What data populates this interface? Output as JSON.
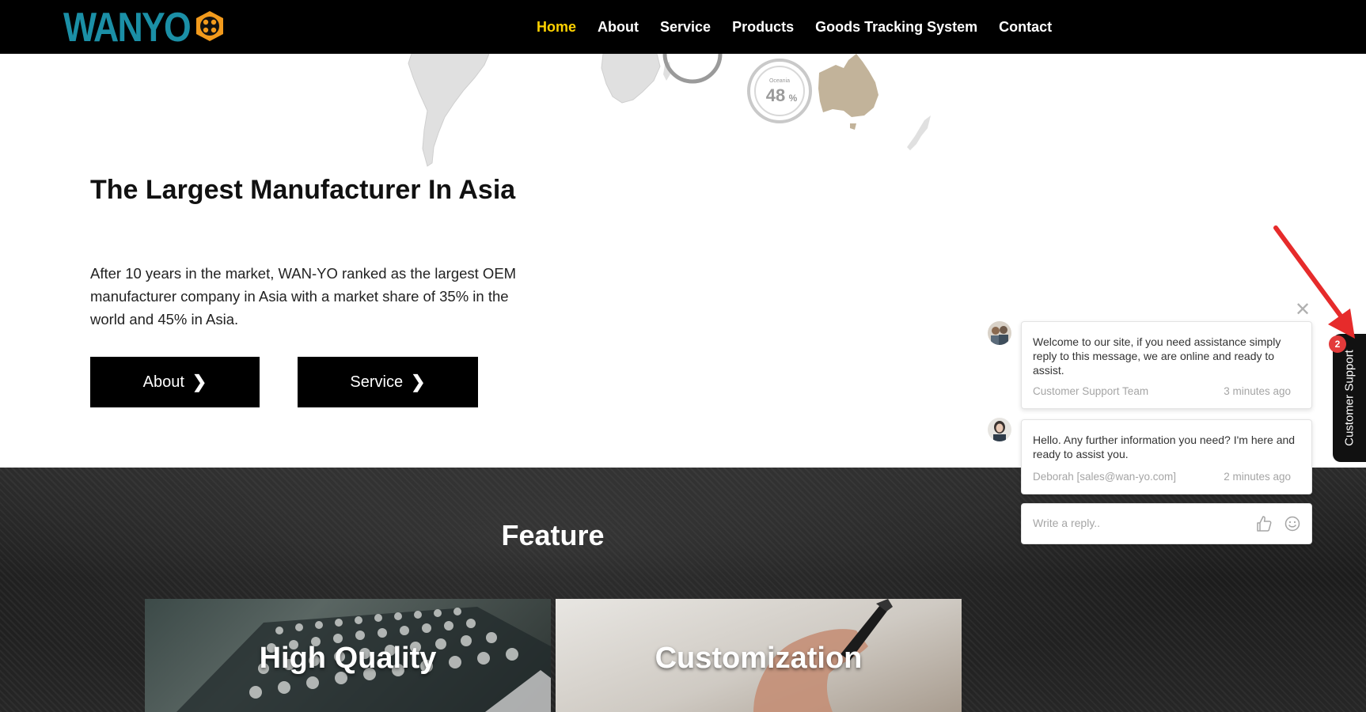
{
  "header": {
    "logo_text": "WANYO",
    "nav": [
      {
        "label": "Home",
        "active": true
      },
      {
        "label": "About",
        "active": false
      },
      {
        "label": "Service",
        "active": false
      },
      {
        "label": "Products",
        "active": false
      },
      {
        "label": "Goods Tracking System",
        "active": false
      },
      {
        "label": "Contact",
        "active": false
      }
    ]
  },
  "map": {
    "region_label": "Oceania",
    "share_value": "48",
    "share_unit": "%"
  },
  "intro": {
    "title": "The Largest Manufacturer In Asia",
    "text": "After 10 years in the market, WAN-YO ranked as the largest OEM manufacturer company in Asia with a market share of 35% in the world and 45% in Asia.",
    "buttons": [
      {
        "label": "About"
      },
      {
        "label": "Service"
      }
    ]
  },
  "feature": {
    "title": "Feature",
    "cards": [
      {
        "title": "High Quality"
      },
      {
        "title": "Customization"
      }
    ]
  },
  "chat": {
    "messages": [
      {
        "text": "Welcome to our site, if you need assistance simply reply to this message, we are online and ready to assist.",
        "sender": "Customer Support Team",
        "time": "3 minutes ago"
      },
      {
        "text": "Hello. Any further information you need?  I'm here and ready to assist you.",
        "sender": "Deborah [sales@wan-yo.com]",
        "time": "2 minutes ago"
      }
    ],
    "reply_placeholder": "Write a reply..",
    "tab_label": "Customer Support",
    "badge_count": "2"
  },
  "colors": {
    "nav_active": "#ffd200",
    "logo_teal": "#1b8fa6",
    "logo_orange": "#f29a1c",
    "badge_red": "#e33a3a",
    "arrow_red": "#e62b2b",
    "australia": "#c2b39a"
  }
}
